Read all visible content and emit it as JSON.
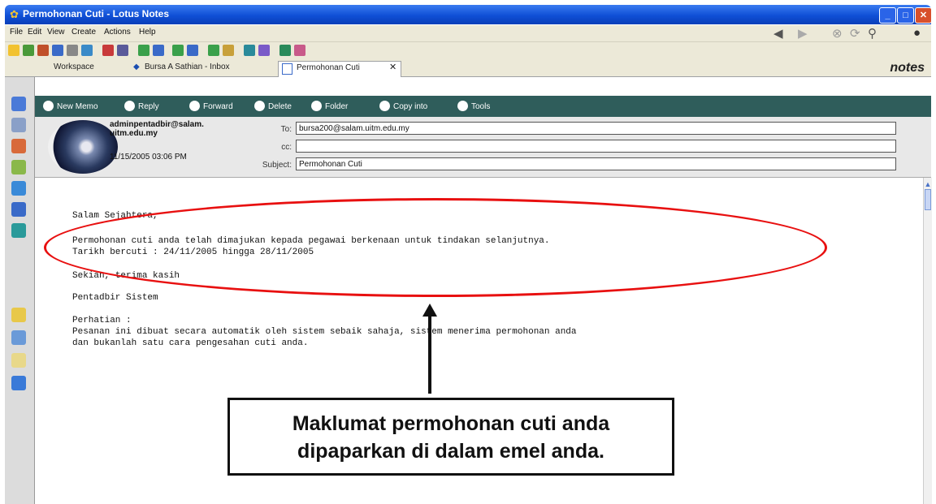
{
  "window": {
    "title": "Permohonan Cuti - Lotus Notes",
    "controls": [
      "minimize",
      "maximize",
      "close"
    ]
  },
  "menu": {
    "items": [
      "File",
      "Edit",
      "View",
      "Create",
      "Actions",
      "Help"
    ]
  },
  "tabs": {
    "items": [
      {
        "label": "Workspace"
      },
      {
        "label": "Bursa A Sathian - Inbox"
      },
      {
        "label": "Permohonan Cuti"
      }
    ],
    "active_index": 2,
    "brand": "notes"
  },
  "action_bar": {
    "items": [
      "New Memo",
      "Reply",
      "Forward",
      "Delete",
      "Folder",
      "Copy into",
      "Tools"
    ]
  },
  "email": {
    "sender_line1": "adminpentadbir@salam.",
    "sender_line2": "uitm.edu.my",
    "date": "11/15/2005 03:06 PM",
    "to_label": "To:",
    "to_value": "bursa200@salam.uitm.edu.my",
    "cc_label": "cc:",
    "cc_value": "",
    "subject_label": "Subject:",
    "subject_value": "Permohonan Cuti"
  },
  "body": {
    "greeting": "Salam Sejahtera,",
    "line1": "Permohonan cuti anda telah dimajukan kepada pegawai berkenaan untuk tindakan selanjutnya.",
    "line2": "Tarikh bercuti : 24/11/2005 hingga 28/11/2005",
    "thanks": "Sekian, terima kasih",
    "signature": "Pentadbir Sistem",
    "note_title": "Perhatian :",
    "note_line1": "Pesanan ini dibuat secara automatik oleh sistem sebaik sahaja, sistem menerima permohonan anda",
    "note_line2": "dan bukanlah satu cara pengesahan cuti anda."
  },
  "annotation": {
    "line1": "Maklumat permohonan cuti anda",
    "line2": "dipaparkan di dalam emel anda.",
    "highlight_color": "#e81010"
  }
}
